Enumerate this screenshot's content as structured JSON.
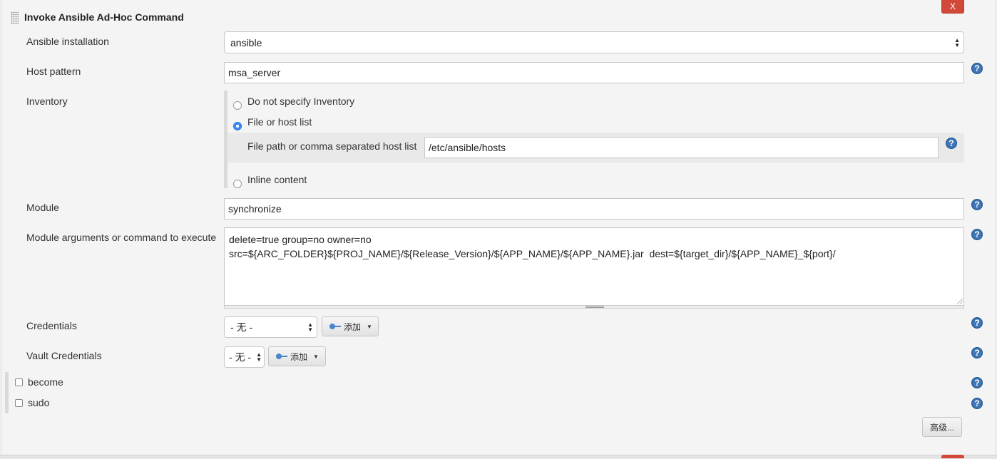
{
  "section": {
    "title": "Invoke Ansible Ad-Hoc Command",
    "delete_label": "X"
  },
  "installation": {
    "label": "Ansible installation",
    "value": "ansible"
  },
  "host_pattern": {
    "label": "Host pattern",
    "value": "msa_server"
  },
  "inventory": {
    "label": "Inventory",
    "options": [
      {
        "label": "Do not specify Inventory",
        "checked": false
      },
      {
        "label": "File or host list",
        "checked": true
      },
      {
        "label": "Inline content",
        "checked": false
      }
    ],
    "file_path": {
      "label": "File path or comma separated host list",
      "value": "/etc/ansible/hosts"
    }
  },
  "module": {
    "label": "Module",
    "value": "synchronize"
  },
  "module_args": {
    "label": "Module arguments or command to execute",
    "value": "delete=true group=no owner=no\nsrc=${ARC_FOLDER}${PROJ_NAME}/${Release_Version}/${APP_NAME}/${APP_NAME}.jar  dest=${target_dir}/${APP_NAME}_${port}/"
  },
  "credentials": {
    "label": "Credentials",
    "value": "- 无 -",
    "add_label": "添加"
  },
  "vault_credentials": {
    "label": "Vault Credentials",
    "value": "- 无 -",
    "add_label": "添加"
  },
  "checkboxes": {
    "become": {
      "label": "become",
      "checked": false
    },
    "sudo": {
      "label": "sudo",
      "checked": false
    }
  },
  "advanced_label": "高级...",
  "help_glyph": "?",
  "colors": {
    "delete": "#d24939",
    "help": "#3f77b7",
    "radio_checked": "#3d8bf7"
  }
}
